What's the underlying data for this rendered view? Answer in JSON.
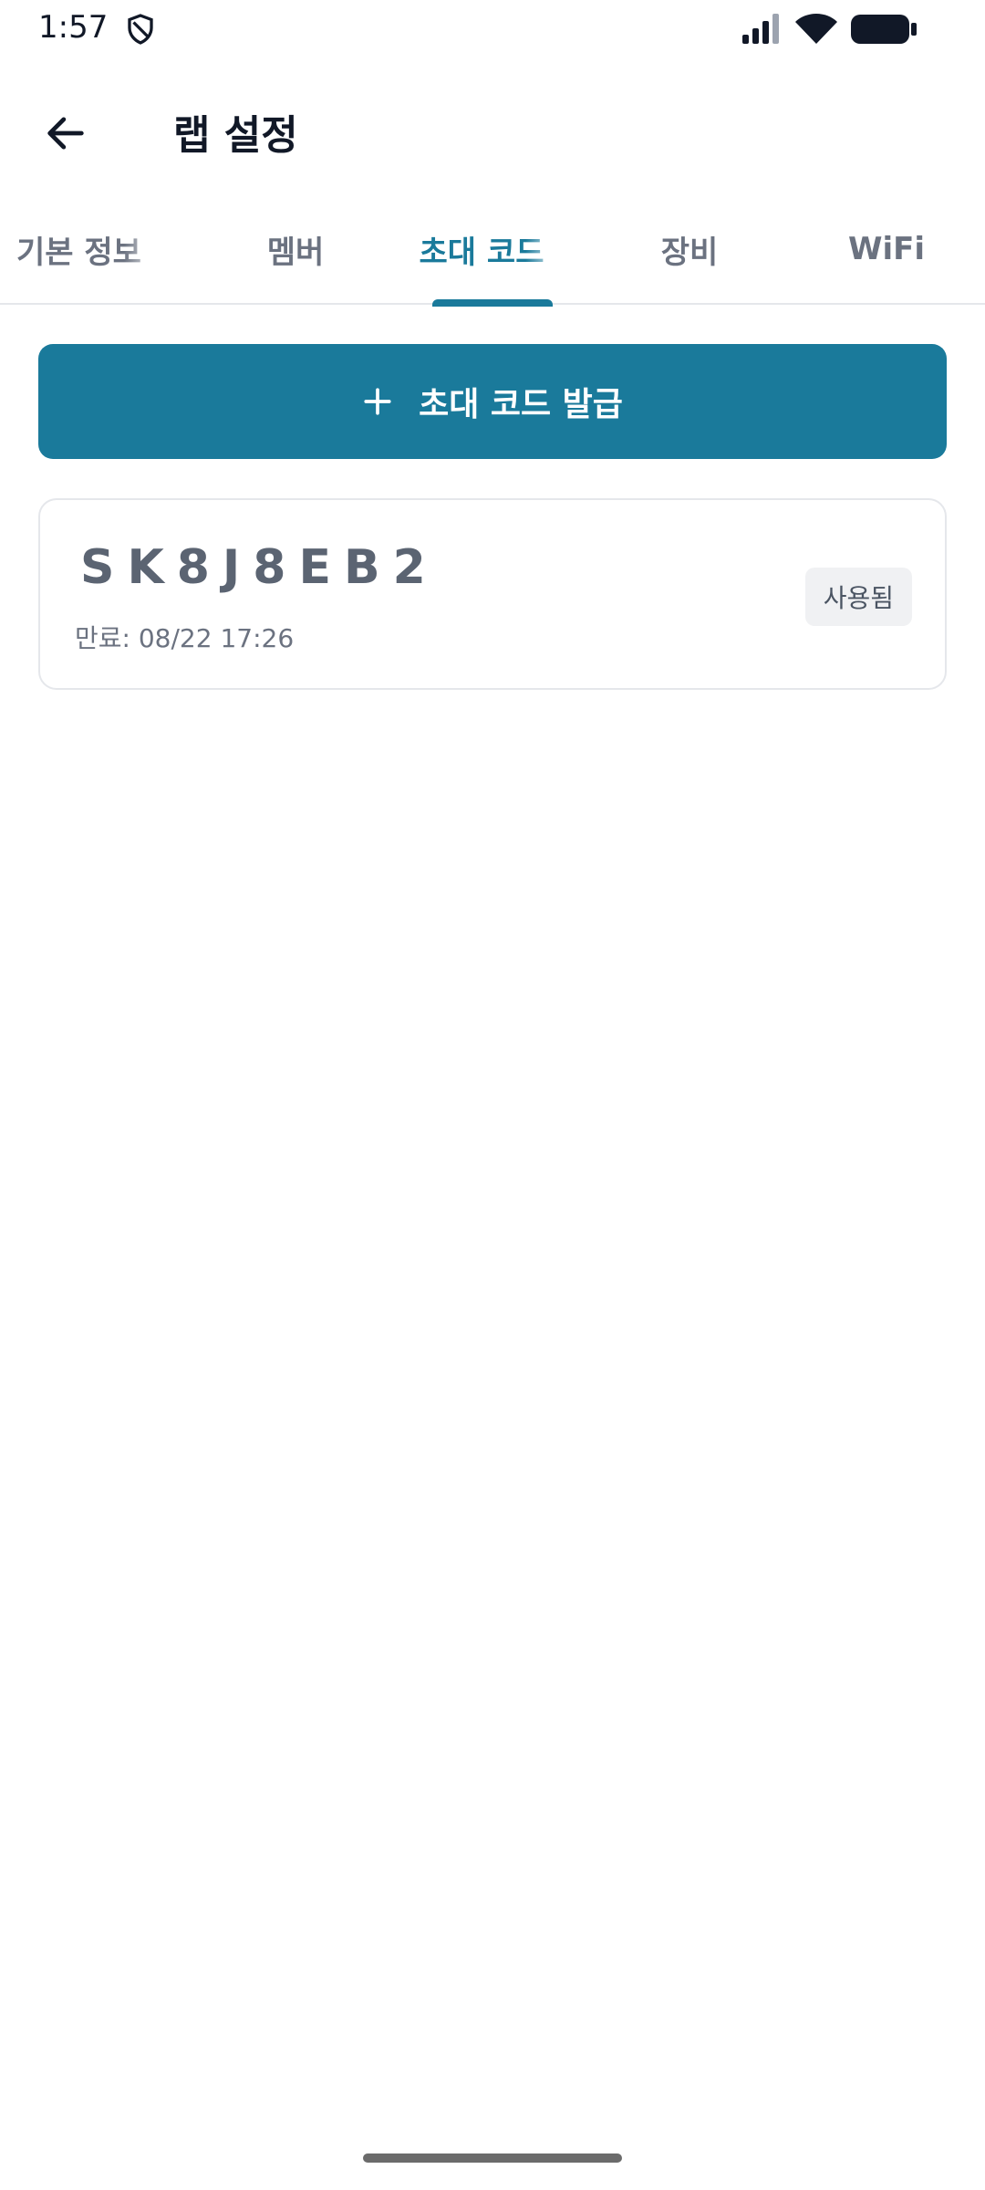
{
  "status_bar": {
    "time": "1:57"
  },
  "header": {
    "title": "랩 설정"
  },
  "tabs": [
    {
      "label": "기본 정보"
    },
    {
      "label": "멤버"
    },
    {
      "label": "초대 코드"
    },
    {
      "label": "장비"
    },
    {
      "label": "WiFi"
    }
  ],
  "actions": {
    "issue_label": "초대 코드 발급"
  },
  "codes": [
    {
      "code": "SK8J8EB2",
      "expiry": "만료: 08/22 17:26",
      "status": "사용됨"
    }
  ],
  "colors": {
    "accent": "#1a7a9b",
    "text_muted": "#6b7280"
  }
}
